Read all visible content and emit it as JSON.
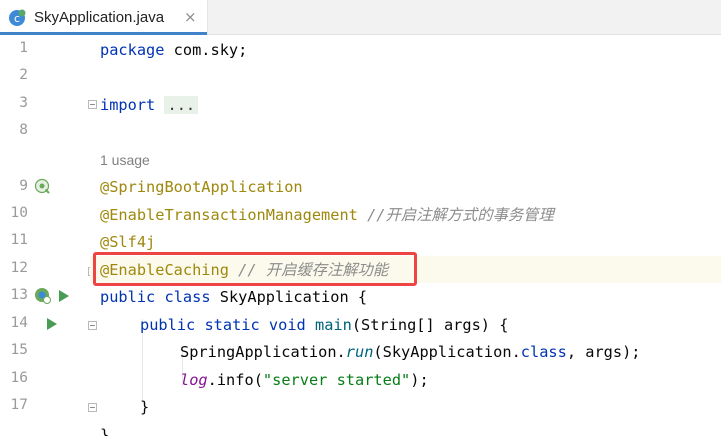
{
  "tab": {
    "title": "SkyApplication.java",
    "close_glyph": "×",
    "icon": "java-class-icon"
  },
  "gutter": {
    "line_numbers": [
      "1",
      "2",
      "3",
      "8",
      "",
      "9",
      "10",
      "11",
      "12",
      "13",
      "14",
      "15",
      "16",
      "17",
      ""
    ],
    "icons": {
      "line9": "spring-bean-icon",
      "line13": [
        "spring-bean-icon",
        "run-icon"
      ],
      "line14": "run-icon"
    }
  },
  "code": {
    "l1_kw": "package",
    "l1_rest": " com.sky;",
    "l3_kw": "import",
    "l3_folded": "...",
    "usage": "1 usage",
    "l9": "@SpringBootApplication",
    "l10_ann": "@EnableTransactionManagement",
    "l10_cm": " //开启注解方式的事务管理",
    "l11": "@Slf4j",
    "l12_ann": "@EnableCaching",
    "l12_cm": " // 开启缓存注解功能",
    "l13_kw1": "public",
    "l13_kw2": "class",
    "l13_rest": " SkyApplication {",
    "l14_kw": "public static void",
    "l14_fn": "main",
    "l14_rest": "(String[] args) {",
    "l15_a": "SpringApplication.",
    "l15_run": "run",
    "l15_b": "(SkyApplication.",
    "l15_kw": "class",
    "l15_c": ", args);",
    "l16_log": "log",
    "l16_a": ".info(",
    "l16_str": "\"server started\"",
    "l16_b": ");",
    "l17": "}",
    "l18": "}"
  },
  "colors": {
    "keyword": "#0033b3",
    "annotation": "#9e880d",
    "comment": "#8c8c8c",
    "string": "#067d17",
    "highlight_box": "#ef4444"
  }
}
